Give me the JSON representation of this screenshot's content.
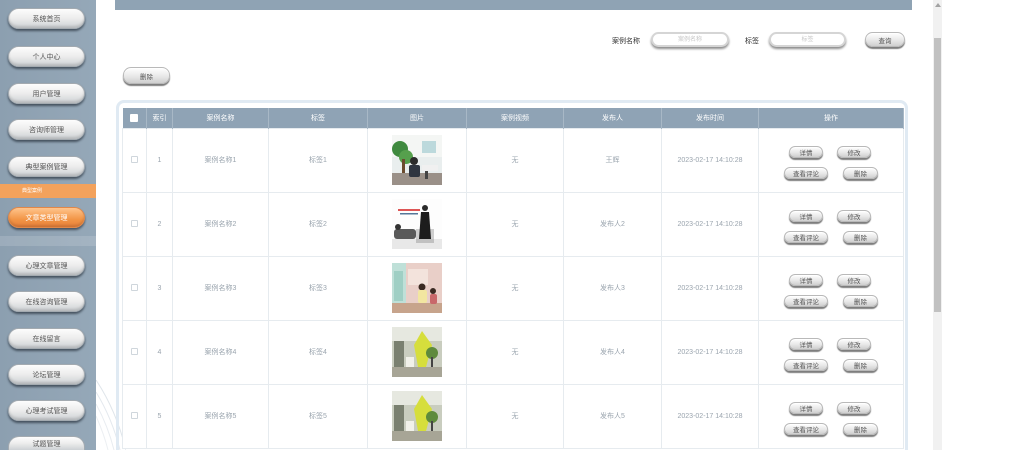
{
  "sidebar": {
    "items": [
      {
        "label": "系统首页"
      },
      {
        "label": "个人中心"
      },
      {
        "label": "用户管理"
      },
      {
        "label": "咨询师管理"
      },
      {
        "label": "典型案例管理"
      },
      {
        "label": "文章类型管理",
        "active": true
      },
      {
        "label": "心理文章管理"
      },
      {
        "label": "在线咨询管理"
      },
      {
        "label": "在线留言"
      },
      {
        "label": "论坛管理"
      },
      {
        "label": "心理考试管理"
      },
      {
        "label": "试题管理"
      }
    ],
    "section_title": "典型案例"
  },
  "search": {
    "name_label": "案例名称",
    "name_placeholder": "案例名称",
    "tag_label": "标签",
    "tag_placeholder": "标签",
    "query_button": "查询"
  },
  "toolbar": {
    "delete_button": "删除"
  },
  "table": {
    "columns": [
      "索引",
      "案例名称",
      "标签",
      "图片",
      "案例视频",
      "发布人",
      "发布时间",
      "操作"
    ],
    "rows": [
      {
        "index": "1",
        "name": "案例名称1",
        "tag": "标签1",
        "video": "无",
        "publisher": "王辉",
        "time": "2023-02-17 14:10:28"
      },
      {
        "index": "2",
        "name": "案例名称2",
        "tag": "标签2",
        "video": "无",
        "publisher": "发布人2",
        "time": "2023-02-17 14:10:28"
      },
      {
        "index": "3",
        "name": "案例名称3",
        "tag": "标签3",
        "video": "无",
        "publisher": "发布人3",
        "time": "2023-02-17 14:10:28"
      },
      {
        "index": "4",
        "name": "案例名称4",
        "tag": "标签4",
        "video": "无",
        "publisher": "发布人4",
        "time": "2023-02-17 14:10:28"
      },
      {
        "index": "5",
        "name": "案例名称5",
        "tag": "标签5",
        "video": "无",
        "publisher": "发布人5",
        "time": "2023-02-17 14:10:28"
      }
    ],
    "actions": {
      "detail": "详情",
      "edit": "修改",
      "comments": "查看评论",
      "delete": "删除"
    }
  },
  "colors": {
    "sidebar": "#8c9fb0",
    "header": "#8fa3b5",
    "active": "#f29546"
  }
}
